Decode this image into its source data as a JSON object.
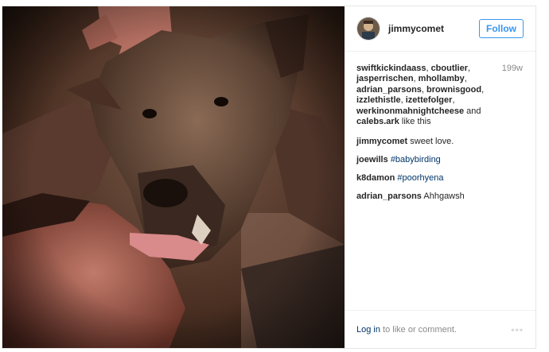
{
  "header": {
    "username": "jimmycomet",
    "follow_label": "Follow"
  },
  "likes": {
    "users": [
      "swiftkickindaass",
      "cboutlier",
      "jasperrischen",
      "mhollamby",
      "adrian_parsons",
      "brownisgood",
      "izzlethistle",
      "izettefolger",
      "werkinonmahnightcheese",
      "calebs.ark"
    ],
    "and_text": "and",
    "like_text": "like this",
    "age": "199w"
  },
  "comments": [
    {
      "user": "jimmycomet",
      "text": "sweet love.",
      "tag": ""
    },
    {
      "user": "joewills",
      "text": "",
      "tag": "#babybirding"
    },
    {
      "user": "k8damon",
      "text": "",
      "tag": "#poorhyena"
    },
    {
      "user": "adrian_parsons",
      "text": "Ahhgawsh",
      "tag": ""
    }
  ],
  "footer": {
    "login_label": "Log in",
    "rest_text": "to like or comment.",
    "more_icon": "◦◦◦"
  },
  "colors": {
    "accent": "#3897f0",
    "hashtag": "#003569"
  }
}
